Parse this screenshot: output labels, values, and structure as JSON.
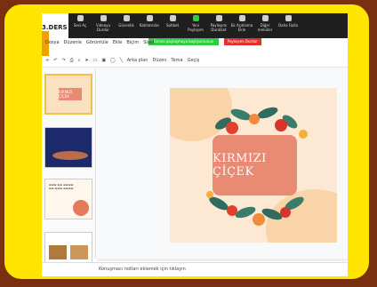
{
  "zoom_toolbar": {
    "items": [
      "Sesi Aç",
      "Videoyu Durdur",
      "Güvenlik",
      "Katılımcılar",
      "Sohbet",
      "Yeni Paylaşım",
      "Paylaşımı Duraklat",
      "Ek Açıklama Ekle",
      "Diğer menüler",
      "Daha Fazla"
    ]
  },
  "share_bar": {
    "sharing_label": "Ekranı paylaşmaya başlıyorsunuz",
    "stop_label": "Paylaşımı Durdur"
  },
  "document": {
    "title": "3.DERS",
    "menu": [
      "Dosya",
      "Düzenle",
      "Görüntüle",
      "Ekle",
      "Biçim",
      "Slayt"
    ],
    "toolbar": [
      "Arka plan",
      "Düzen",
      "Tema",
      "Geçiş"
    ]
  },
  "slide": {
    "title": "KIRMIZI ÇİÇEK"
  },
  "thumbnails": [
    {
      "label": "KIRMIZI ÇİÇEK"
    },
    {
      "label": ""
    },
    {
      "label": ""
    },
    {
      "label": ""
    }
  ],
  "notes": {
    "placeholder": "Konuşmacı notları eklemek için tıklayın"
  },
  "colors": {
    "frame": "#ffe500",
    "border": "#7a2f0f",
    "slide_bg": "#fde9d3",
    "title_box": "#e98a72",
    "share_green": "#2ecc40",
    "stop_red": "#e03030"
  }
}
